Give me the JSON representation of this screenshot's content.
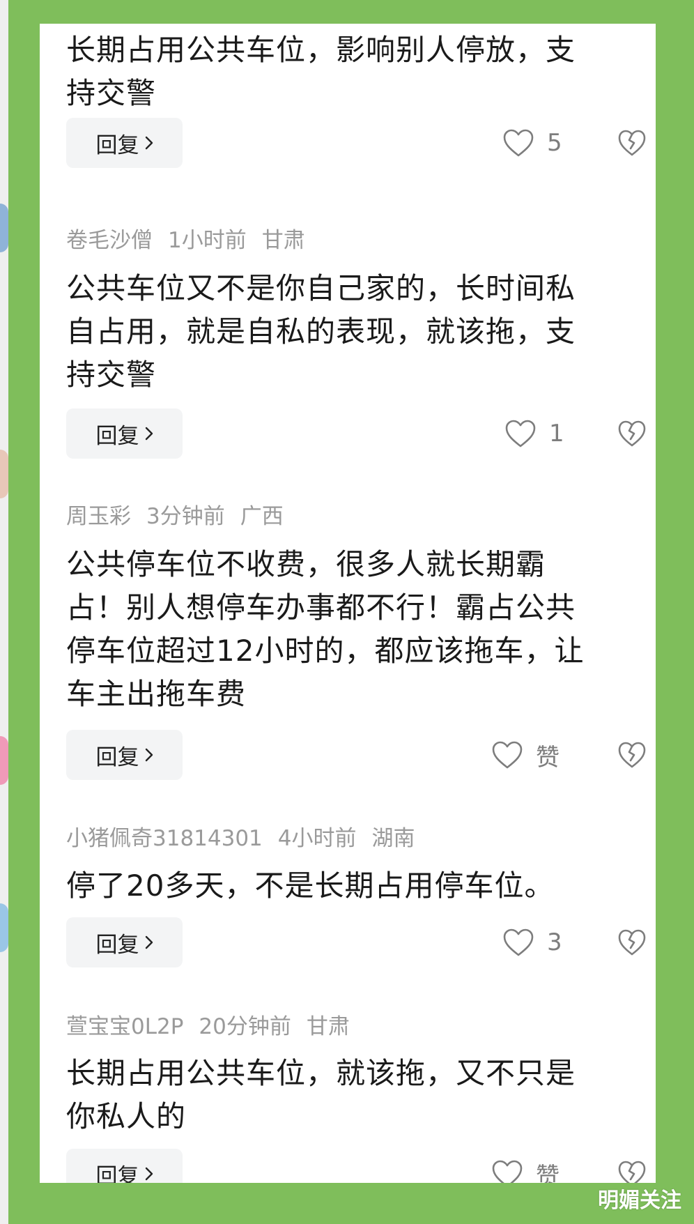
{
  "comments": [
    {
      "user": "",
      "time": "",
      "location": "",
      "lines": [
        "长期占用公共车位，影响别人停放，支",
        "持交警"
      ],
      "reply_label": "回复",
      "likes": "5"
    },
    {
      "user": "卷毛沙僧",
      "time": "1小时前",
      "location": "甘肃",
      "lines": [
        "公共车位又不是你自己家的，长时间私",
        "自占用，就是自私的表现，就该拖，支",
        "持交警"
      ],
      "reply_label": "回复",
      "likes": "1"
    },
    {
      "user": "周玉彩",
      "time": "3分钟前",
      "location": "广西",
      "lines": [
        "公共停车位不收费，很多人就长期霸",
        "占！别人想停车办事都不行！霸占公共",
        "停车位超过12小时的，都应该拖车，让",
        "车主出拖车费"
      ],
      "reply_label": "回复",
      "likes": "赞"
    },
    {
      "user": "小猪佩奇31814301",
      "time": "4小时前",
      "location": "湖南",
      "lines": [
        "停了20多天，不是长期占用停车位。"
      ],
      "reply_label": "回复",
      "likes": "3"
    },
    {
      "user": "萱宝宝0L2P",
      "time": "20分钟前",
      "location": "甘肃",
      "lines": [
        "长期占用公共车位，就该拖，又不只是",
        "你私人的"
      ],
      "reply_label": "回复",
      "likes": "赞"
    }
  ],
  "watermark": "明媚关注",
  "colors": {
    "frame_green": "#7fbe5b",
    "panel_bg": "#ffffff",
    "meta_gray": "#9a9a9a",
    "icon_gray": "#7d7d7d",
    "reply_bg": "#f3f4f5"
  },
  "icons": {
    "like": "heart-outline-icon",
    "dislike": "broken-heart-icon",
    "reply": "chevron-right-icon"
  }
}
